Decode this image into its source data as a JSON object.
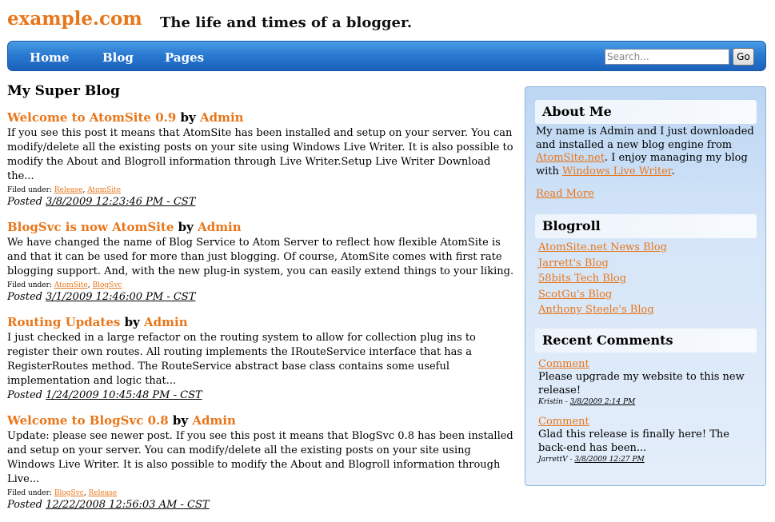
{
  "header": {
    "site_title": "example.com",
    "tagline": "The life and times of a blogger."
  },
  "nav": {
    "items": [
      {
        "label": "Home"
      },
      {
        "label": "Blog"
      },
      {
        "label": "Pages"
      }
    ],
    "search_placeholder": "Search...",
    "search_button": "Go"
  },
  "main": {
    "page_title": "My Super Blog",
    "by_label": "by",
    "filed_label": "Filed under:",
    "posted_label": "Posted",
    "posts": [
      {
        "title": "Welcome to AtomSite 0.9",
        "author": "Admin",
        "body": "If you see this post it means that AtomSite has been installed and setup on your server.  You can modify/delete all the existing posts on your site using Windows Live Writer.  It is also possible to modify the About and Blogroll information through Live Writer.Setup Live Writer Download the...",
        "tags": [
          "Release",
          "AtomSite"
        ],
        "date": "3/8/2009 12:23:46 PM - CST"
      },
      {
        "title": "BlogSvc is now AtomSite",
        "author": "Admin",
        "body": "We have changed the name of Blog Service to Atom Server to reflect how flexible AtomSite is and that it can be used for more than just blogging.  Of course, AtomSite comes with first rate blogging support.  And, with the new plug-in system, you can easily extend things to your liking.",
        "tags": [
          "AtomSite",
          "BlogSvc"
        ],
        "date": "3/1/2009 12:46:00 PM - CST"
      },
      {
        "title": "Routing Updates",
        "author": "Admin",
        "body": "I just checked in a large refactor on the routing system to allow for collection plug ins to register their own routes.  All routing implements the IRouteService interface that has a RegisterRoutes method.  The RouteService abstract base class contains some useful implementation and logic that...",
        "tags": [],
        "date": "1/24/2009 10:45:48 PM - CST"
      },
      {
        "title": "Welcome to BlogSvc 0.8",
        "author": "Admin",
        "body": "Update: please see newer post. If you see this post it means that BlogSvc 0.8 has been installed and setup on  your server.  You can modify/delete all the existing posts on your site using Windows Live Writer.  It is also possible to modify the About and Blogroll information through Live...",
        "tags": [
          "BlogSvc",
          "Release"
        ],
        "date": "12/22/2008 12:56:03 AM - CST"
      }
    ]
  },
  "sidebar": {
    "about": {
      "heading": "About Me",
      "text_1": "My name is Admin and I just downloaded and installed a new blog engine from ",
      "link_1": "AtomSite.net",
      "text_2": ". I enjoy managing my blog with ",
      "link_2": "Windows Live Writer",
      "text_3": ".",
      "read_more": "Read More"
    },
    "blogroll": {
      "heading": "Blogroll",
      "links": [
        "AtomSite.net News Blog",
        "Jarrett's Blog",
        "58bits Tech Blog",
        "ScotGu's Blog",
        "Anthony Steele's Blog"
      ]
    },
    "recent_comments": {
      "heading": "Recent Comments",
      "items": [
        {
          "link": "Comment",
          "text": "Please upgrade my website to this new release!",
          "author": "Kristin",
          "date": "3/8/2009 2:14 PM"
        },
        {
          "link": "Comment",
          "text": "Glad this release is finally here! The back-end has been...",
          "author": "JarrettV",
          "date": "3/8/2009 12:27 PM"
        }
      ]
    }
  },
  "colors": {
    "accent": "#e8761a",
    "nav_bar": "#2a7ad2",
    "sidebar_bg": "#d6e6f8"
  }
}
